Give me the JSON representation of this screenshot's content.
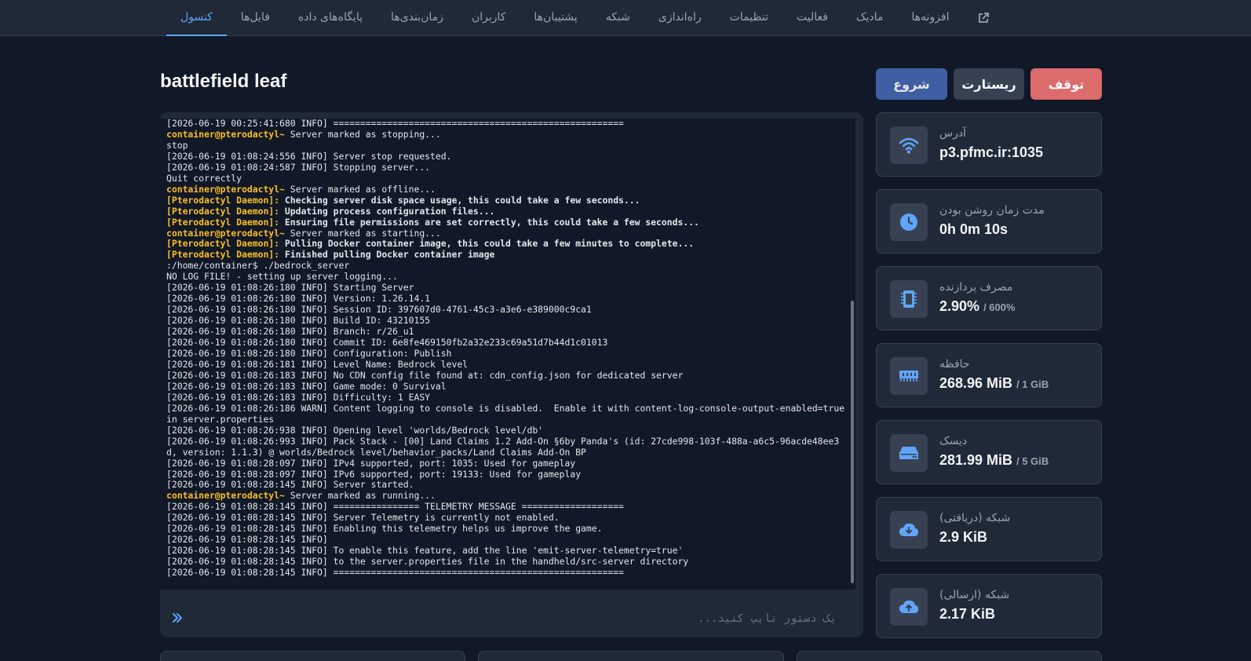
{
  "nav": {
    "items": [
      {
        "label": "کنسول",
        "active": true
      },
      {
        "label": "فایل‌ها"
      },
      {
        "label": "پایگاه‌های داده"
      },
      {
        "label": "زمان‌بندی‌ها"
      },
      {
        "label": "کاربران"
      },
      {
        "label": "پشتیبان‌ها"
      },
      {
        "label": "شبکه"
      },
      {
        "label": "راه‌اندازی"
      },
      {
        "label": "تنظیمات"
      },
      {
        "label": "فعالیت"
      },
      {
        "label": "مادیک"
      },
      {
        "label": "افزونه‌ها"
      }
    ],
    "external_icon": "external-link-icon"
  },
  "server": {
    "title": "battlefield leaf"
  },
  "buttons": {
    "start": "شروع",
    "restart": "ریستارت",
    "stop": "توقف"
  },
  "console": {
    "lines": [
      {
        "text": "[2026-06-19 00:25:41:680 INFO] ======================================================"
      },
      {
        "prefix": "container@pterodactyl~",
        "text": " Server marked as stopping..."
      },
      {
        "text": "stop"
      },
      {
        "text": "[2026-06-19 01:08:24:556 INFO] Server stop requested."
      },
      {
        "text": "[2026-06-19 01:08:24:587 INFO] Stopping server..."
      },
      {
        "text": "Quit correctly"
      },
      {
        "prefix": "container@pterodactyl~",
        "text": " Server marked as offline..."
      },
      {
        "prefix": "[Pterodactyl Daemon]:",
        "text": " Checking server disk space usage, this could take a few seconds...",
        "daemon": true
      },
      {
        "prefix": "[Pterodactyl Daemon]:",
        "text": " Updating process configuration files...",
        "daemon": true
      },
      {
        "prefix": "[Pterodactyl Daemon]:",
        "text": " Ensuring file permissions are set correctly, this could take a few seconds...",
        "daemon": true
      },
      {
        "prefix": "container@pterodactyl~",
        "text": " Server marked as starting..."
      },
      {
        "prefix": "[Pterodactyl Daemon]:",
        "text": " Pulling Docker container image, this could take a few minutes to complete...",
        "daemon": true
      },
      {
        "prefix": "[Pterodactyl Daemon]:",
        "text": " Finished pulling Docker container image",
        "daemon": true
      },
      {
        "text": ":/home/container$ ./bedrock_server"
      },
      {
        "text": "NO LOG FILE! - setting up server logging..."
      },
      {
        "text": "[2026-06-19 01:08:26:180 INFO] Starting Server"
      },
      {
        "text": "[2026-06-19 01:08:26:180 INFO] Version: 1.26.14.1"
      },
      {
        "text": "[2026-06-19 01:08:26:180 INFO] Session ID: 397607d0-4761-45c3-a3e6-e389000c9ca1"
      },
      {
        "text": "[2026-06-19 01:08:26:180 INFO] Build ID: 43210155"
      },
      {
        "text": "[2026-06-19 01:08:26:180 INFO] Branch: r/26_u1"
      },
      {
        "text": "[2026-06-19 01:08:26:180 INFO] Commit ID: 6e8fe469150fb2a32e233c69a51d7b44d1c01013"
      },
      {
        "text": "[2026-06-19 01:08:26:180 INFO] Configuration: Publish"
      },
      {
        "text": "[2026-06-19 01:08:26:181 INFO] Level Name: Bedrock level"
      },
      {
        "text": "[2026-06-19 01:08:26:183 INFO] No CDN config file found at: cdn_config.json for dedicated server"
      },
      {
        "text": "[2026-06-19 01:08:26:183 INFO] Game mode: 0 Survival"
      },
      {
        "text": "[2026-06-19 01:08:26:183 INFO] Difficulty: 1 EASY"
      },
      {
        "text": "[2026-06-19 01:08:26:186 WARN] Content logging to console is disabled.  Enable it with content-log-console-output-enabled=true in server.properties"
      },
      {
        "text": "[2026-06-19 01:08:26:938 INFO] Opening level 'worlds/Bedrock level/db'"
      },
      {
        "text": "[2026-06-19 01:08:26:993 INFO] Pack Stack - [00] Land Claims 1.2 Add-On §6by Panda's (id: 27cde998-103f-488a-a6c5-96acde48ee3d, version: 1.1.3) @ worlds/Bedrock level/behavior_packs/Land Claims Add-On BP"
      },
      {
        "text": "[2026-06-19 01:08:28:097 INFO] IPv4 supported, port: 1035: Used for gameplay"
      },
      {
        "text": "[2026-06-19 01:08:28:097 INFO] IPv6 supported, port: 19133: Used for gameplay"
      },
      {
        "text": "[2026-06-19 01:08:28:145 INFO] Server started."
      },
      {
        "prefix": "container@pterodactyl~",
        "text": " Server marked as running..."
      },
      {
        "text": "[2026-06-19 01:08:28:145 INFO] ================ TELEMETRY MESSAGE ==================="
      },
      {
        "text": "[2026-06-19 01:08:28:145 INFO] Server Telemetry is currently not enabled."
      },
      {
        "text": "[2026-06-19 01:08:28:145 INFO] Enabling this telemetry helps us improve the game."
      },
      {
        "text": "[2026-06-19 01:08:28:145 INFO]"
      },
      {
        "text": "[2026-06-19 01:08:28:145 INFO] To enable this feature, add the line 'emit-server-telemetry=true'"
      },
      {
        "text": "[2026-06-19 01:08:28:145 INFO] to the server.properties file in the handheld/src-server directory"
      },
      {
        "text": "[2026-06-19 01:08:28:145 INFO] ======================================================"
      }
    ],
    "command_placeholder": "یک دستور تایپ کنید...",
    "command_icon": "double-chevron-icon"
  },
  "stats": [
    {
      "label": "آدرس",
      "value": "p3.pfmc.ir:1035",
      "limit": "",
      "icon": "wifi-icon"
    },
    {
      "label": "مدت زمان روشن بودن",
      "value": "0h 0m 10s",
      "limit": "",
      "icon": "clock-icon"
    },
    {
      "label": "مصرف پردازنده",
      "value": "2.90%",
      "limit": "/ 600%",
      "icon": "cpu-icon"
    },
    {
      "label": "حافظه",
      "value": "268.96 MiB",
      "limit": "/ 1 GiB",
      "icon": "memory-icon"
    },
    {
      "label": "دیسک",
      "value": "281.99 MiB",
      "limit": "/ 5 GiB",
      "icon": "disk-icon"
    },
    {
      "label": "شبکه (دریافتی)",
      "value": "2.9 KiB",
      "limit": "",
      "icon": "cloud-download-icon"
    },
    {
      "label": "شبکه (ارسالی)",
      "value": "2.17 KiB",
      "limit": "",
      "icon": "cloud-upload-icon"
    }
  ],
  "colors": {
    "accent": "#60a5fa",
    "start": "#3f5ea3",
    "restart": "#374151",
    "stop": "#dc6b6b",
    "prompt": "#fbbf24"
  }
}
